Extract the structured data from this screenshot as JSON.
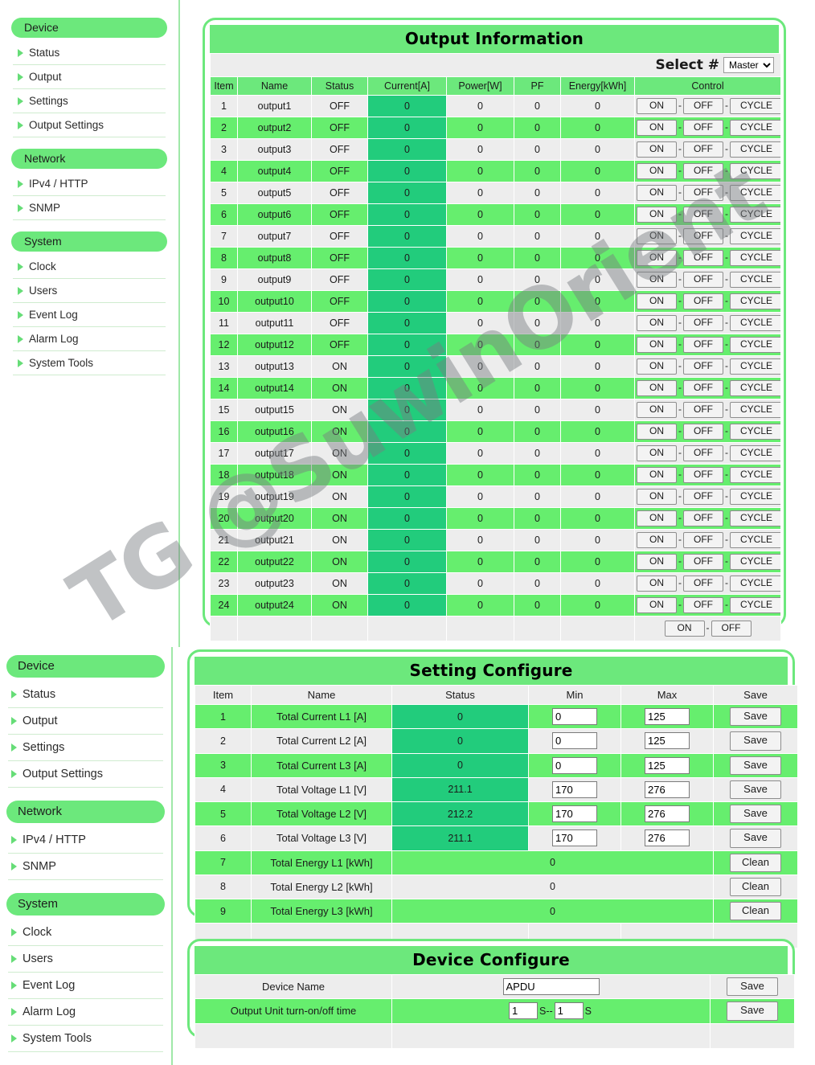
{
  "sidebar": {
    "groups": [
      {
        "label": "Device",
        "items": [
          "Status",
          "Output",
          "Settings",
          "Output Settings"
        ]
      },
      {
        "label": "Network",
        "items": [
          "IPv4 / HTTP",
          "SNMP"
        ]
      },
      {
        "label": "System",
        "items": [
          "Clock",
          "Users",
          "Event Log",
          "Alarm Log",
          "System Tools"
        ]
      }
    ]
  },
  "watermark": {
    "text": "TG @SuwinOrient"
  },
  "output_panel": {
    "title": "Output Information",
    "select_label": "Select #",
    "select_value": "Master",
    "select_options": [
      "Master"
    ],
    "columns": [
      "Item",
      "Name",
      "Status",
      "Current[A]",
      "Power[W]",
      "PF",
      "Energy[kWh]",
      "Control"
    ],
    "control_labels": {
      "on": "ON",
      "off": "OFF",
      "cycle": "CYCLE",
      "separator": "-"
    },
    "rows": [
      {
        "item": "1",
        "name": "output1",
        "status": "OFF",
        "current": "0",
        "power": "0",
        "pf": "0",
        "energy": "0"
      },
      {
        "item": "2",
        "name": "output2",
        "status": "OFF",
        "current": "0",
        "power": "0",
        "pf": "0",
        "energy": "0"
      },
      {
        "item": "3",
        "name": "output3",
        "status": "OFF",
        "current": "0",
        "power": "0",
        "pf": "0",
        "energy": "0"
      },
      {
        "item": "4",
        "name": "output4",
        "status": "OFF",
        "current": "0",
        "power": "0",
        "pf": "0",
        "energy": "0"
      },
      {
        "item": "5",
        "name": "output5",
        "status": "OFF",
        "current": "0",
        "power": "0",
        "pf": "0",
        "energy": "0"
      },
      {
        "item": "6",
        "name": "output6",
        "status": "OFF",
        "current": "0",
        "power": "0",
        "pf": "0",
        "energy": "0"
      },
      {
        "item": "7",
        "name": "output7",
        "status": "OFF",
        "current": "0",
        "power": "0",
        "pf": "0",
        "energy": "0"
      },
      {
        "item": "8",
        "name": "output8",
        "status": "OFF",
        "current": "0",
        "power": "0",
        "pf": "0",
        "energy": "0"
      },
      {
        "item": "9",
        "name": "output9",
        "status": "OFF",
        "current": "0",
        "power": "0",
        "pf": "0",
        "energy": "0"
      },
      {
        "item": "10",
        "name": "output10",
        "status": "OFF",
        "current": "0",
        "power": "0",
        "pf": "0",
        "energy": "0"
      },
      {
        "item": "11",
        "name": "output11",
        "status": "OFF",
        "current": "0",
        "power": "0",
        "pf": "0",
        "energy": "0"
      },
      {
        "item": "12",
        "name": "output12",
        "status": "OFF",
        "current": "0",
        "power": "0",
        "pf": "0",
        "energy": "0"
      },
      {
        "item": "13",
        "name": "output13",
        "status": "ON",
        "current": "0",
        "power": "0",
        "pf": "0",
        "energy": "0"
      },
      {
        "item": "14",
        "name": "output14",
        "status": "ON",
        "current": "0",
        "power": "0",
        "pf": "0",
        "energy": "0"
      },
      {
        "item": "15",
        "name": "output15",
        "status": "ON",
        "current": "0",
        "power": "0",
        "pf": "0",
        "energy": "0"
      },
      {
        "item": "16",
        "name": "output16",
        "status": "ON",
        "current": "0",
        "power": "0",
        "pf": "0",
        "energy": "0"
      },
      {
        "item": "17",
        "name": "output17",
        "status": "ON",
        "current": "0",
        "power": "0",
        "pf": "0",
        "energy": "0"
      },
      {
        "item": "18",
        "name": "output18",
        "status": "ON",
        "current": "0",
        "power": "0",
        "pf": "0",
        "energy": "0"
      },
      {
        "item": "19",
        "name": "output19",
        "status": "ON",
        "current": "0",
        "power": "0",
        "pf": "0",
        "energy": "0"
      },
      {
        "item": "20",
        "name": "output20",
        "status": "ON",
        "current": "0",
        "power": "0",
        "pf": "0",
        "energy": "0"
      },
      {
        "item": "21",
        "name": "output21",
        "status": "ON",
        "current": "0",
        "power": "0",
        "pf": "0",
        "energy": "0"
      },
      {
        "item": "22",
        "name": "output22",
        "status": "ON",
        "current": "0",
        "power": "0",
        "pf": "0",
        "energy": "0"
      },
      {
        "item": "23",
        "name": "output23",
        "status": "ON",
        "current": "0",
        "power": "0",
        "pf": "0",
        "energy": "0"
      },
      {
        "item": "24",
        "name": "output24",
        "status": "ON",
        "current": "0",
        "power": "0",
        "pf": "0",
        "energy": "0"
      }
    ],
    "footer": {
      "on": "ON",
      "separator": "-",
      "off": "OFF"
    }
  },
  "setting_panel": {
    "title": "Setting Configure",
    "columns": [
      "Item",
      "Name",
      "Status",
      "Min",
      "Max",
      "Save"
    ],
    "rows": [
      {
        "item": "1",
        "name": "Total Current L1 [A]",
        "status": "0",
        "min": "0",
        "max": "125",
        "action": "Save",
        "type": "minmax"
      },
      {
        "item": "2",
        "name": "Total Current L2 [A]",
        "status": "0",
        "min": "0",
        "max": "125",
        "action": "Save",
        "type": "minmax"
      },
      {
        "item": "3",
        "name": "Total Current L3 [A]",
        "status": "0",
        "min": "0",
        "max": "125",
        "action": "Save",
        "type": "minmax"
      },
      {
        "item": "4",
        "name": "Total Voltage L1 [V]",
        "status": "211.1",
        "min": "170",
        "max": "276",
        "action": "Save",
        "type": "minmax"
      },
      {
        "item": "5",
        "name": "Total Voltage L2 [V]",
        "status": "212.2",
        "min": "170",
        "max": "276",
        "action": "Save",
        "type": "minmax"
      },
      {
        "item": "6",
        "name": "Total Voltage L3 [V]",
        "status": "211.1",
        "min": "170",
        "max": "276",
        "action": "Save",
        "type": "minmax"
      },
      {
        "item": "7",
        "name": "Total Energy L1 [kWh]",
        "status": "0",
        "min": "",
        "max": "",
        "action": "Clean",
        "type": "span"
      },
      {
        "item": "8",
        "name": "Total Energy L2 [kWh]",
        "status": "0",
        "min": "",
        "max": "",
        "action": "Clean",
        "type": "span"
      },
      {
        "item": "9",
        "name": "Total Energy L3 [kWh]",
        "status": "0",
        "min": "",
        "max": "",
        "action": "Clean",
        "type": "span"
      }
    ]
  },
  "device_panel": {
    "title": "Device Configure",
    "device_name_label": "Device Name",
    "device_name_value": "APDU",
    "device_name_save": "Save",
    "turn_time_label": "Output Unit turn-on/off time",
    "turn_on_value": "1",
    "turn_off_value": "1",
    "unit_a": "S--",
    "unit_b": "S",
    "turn_time_save": "Save"
  },
  "colors": {
    "accent_green": "#6ce87c",
    "row_even": "#66ee6e",
    "row_odd": "#ededed",
    "current_cell": "#22cc7c"
  }
}
